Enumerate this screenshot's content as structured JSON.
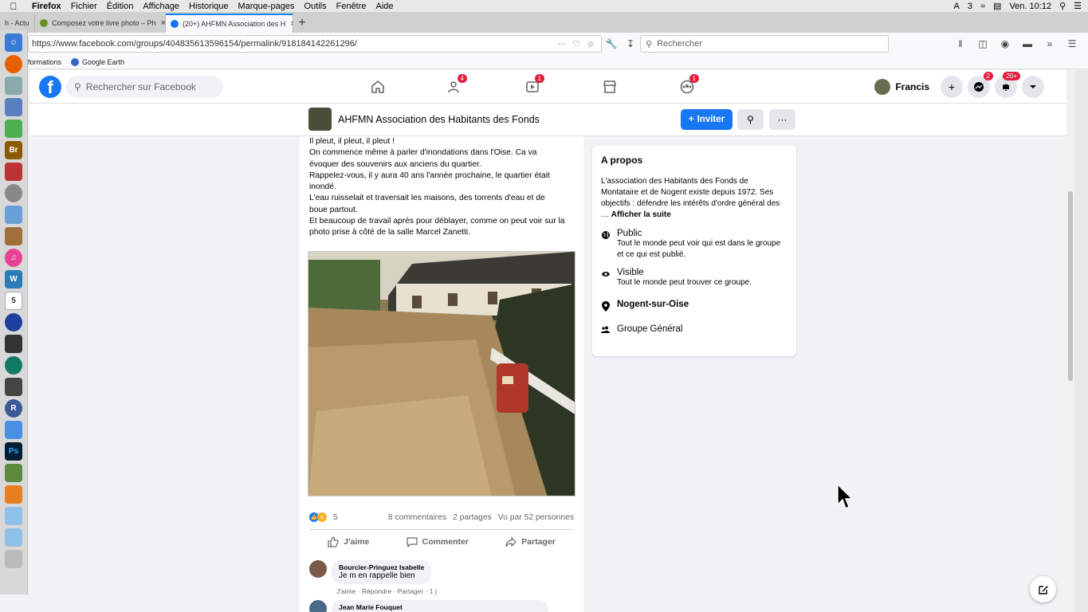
{
  "menubar": {
    "app": "Firefox",
    "items": [
      "Fichier",
      "Édition",
      "Affichage",
      "Historique",
      "Marque-pages",
      "Outils",
      "Fenêtre",
      "Aide"
    ],
    "status_count": "3",
    "clock": "Ven. 10:12"
  },
  "tabs": [
    {
      "label": "h - Actu"
    },
    {
      "label": "Composez votre livre photo – Ph"
    },
    {
      "label": "(20+) AHFMN Association des H"
    }
  ],
  "toolbar": {
    "url": "https://www.facebook.com/groups/404835613596154/permalink/918184142261296/",
    "search_placeholder": "Rechercher"
  },
  "bookmarks": [
    {
      "label": "formations"
    },
    {
      "label": "Google Earth"
    }
  ],
  "facebook": {
    "search_placeholder": "Rechercher sur Facebook",
    "nav_badges": {
      "friends": "4",
      "watch": "1",
      "groups": "1"
    },
    "profile_name": "Francis",
    "messenger_badge": "2",
    "notifications_badge": "20+"
  },
  "group": {
    "name": "AHFMN Association des Habitants des Fonds",
    "invite_label": "Inviter"
  },
  "post": {
    "lines": [
      "Il pleut, il pleut, il pleut !",
      "On commence même à parler d'inondations dans l'Oise. Ca va",
      "évoquer des souvenirs aux anciens du quartier.",
      "Rappelez-vous, il y aura 40 ans l'année prochaine, le quartier était",
      "inondé.",
      "L'eau ruisselait et traversait les maisons, des torrents d'eau et de",
      "boue partout.",
      "Et beaucoup de travail après pour déblayer, comme on peut voir sur la",
      "photo prise à côté de la salle Marcel Zanetti."
    ],
    "reaction_count": "5",
    "comments_count": "8 commentaires",
    "shares_count": "2 partages",
    "views_count": "Vu par 52 personnes",
    "like_label": "J'aime",
    "comment_label": "Commenter",
    "share_label": "Partager",
    "comments": [
      {
        "author": "Bourcier-Pringuez Isabelle",
        "text": "Je m en rappelle bien",
        "meta": "J'aime · Répondre · Partager · 1 j"
      },
      {
        "author": "Jean Marie Fouquet",
        "text": ""
      }
    ]
  },
  "about": {
    "title": "A propos",
    "description": "L'association des Habitants des Fonds de Montataire et de Nogent existe depuis 1972. Ses objectifs : défendre les intérêts d'ordre général des …",
    "see_more": "Afficher la suite",
    "privacy_title": "Public",
    "privacy_desc": "Tout le monde peut voir qui est dans le groupe et ce qui est publié.",
    "visibility_title": "Visible",
    "visibility_desc": "Tout le monde peut trouver ce groupe.",
    "location": "Nogent-sur-Oise",
    "category": "Groupe Général"
  }
}
